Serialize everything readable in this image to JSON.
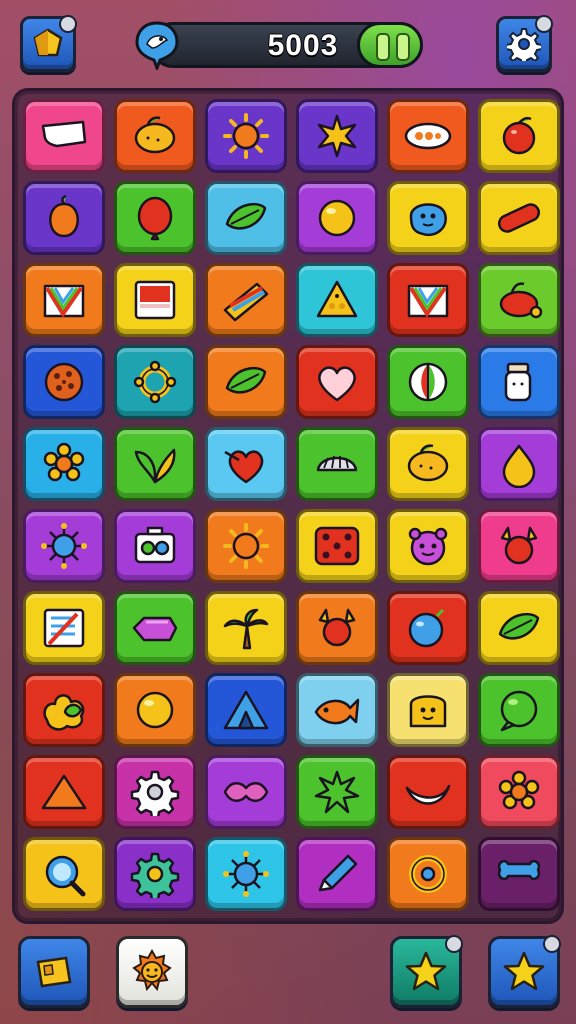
{
  "header": {
    "menu_icon": "gem-icon",
    "score": "5003",
    "settings_icon": "gear-icon",
    "score_badge_icon": "bird-badge-icon"
  },
  "board": {
    "columns": 6,
    "rows": 10,
    "tiles": [
      {
        "color": "#f0468c",
        "icon": "bandage"
      },
      {
        "color": "#f15a1e",
        "icon": "lemon"
      },
      {
        "color": "#6a35c9",
        "icon": "sun"
      },
      {
        "color": "#6a35c9",
        "icon": "star-burst"
      },
      {
        "color": "#f15a1e",
        "icon": "capsule"
      },
      {
        "color": "#f5d21a",
        "icon": "apple"
      },
      {
        "color": "#6a35c9",
        "icon": "peach"
      },
      {
        "color": "#4cc22c",
        "icon": "balloon"
      },
      {
        "color": "#4fbfe8",
        "icon": "leaf"
      },
      {
        "color": "#a43cd8",
        "icon": "orb"
      },
      {
        "color": "#f5d21a",
        "icon": "blob"
      },
      {
        "color": "#f5d21a",
        "icon": "tube"
      },
      {
        "color": "#f07a1c",
        "icon": "prism"
      },
      {
        "color": "#f5d21a",
        "icon": "card"
      },
      {
        "color": "#f07a1c",
        "icon": "ruler"
      },
      {
        "color": "#2ec5d8",
        "icon": "cheese"
      },
      {
        "color": "#e0321e",
        "icon": "prism"
      },
      {
        "color": "#6ccb2c",
        "icon": "cherry"
      },
      {
        "color": "#2456d8",
        "icon": "cookie"
      },
      {
        "color": "#1ea3b0",
        "icon": "ring"
      },
      {
        "color": "#f07a1c",
        "icon": "leaf"
      },
      {
        "color": "#e0321e",
        "icon": "heart"
      },
      {
        "color": "#4cc22c",
        "icon": "ball"
      },
      {
        "color": "#2a7ae8",
        "icon": "jar"
      },
      {
        "color": "#2ab0e8",
        "icon": "flower"
      },
      {
        "color": "#4cc22c",
        "icon": "sprout"
      },
      {
        "color": "#5ac8f0",
        "icon": "heart-pin"
      },
      {
        "color": "#4cc22c",
        "icon": "shell"
      },
      {
        "color": "#f5d21a",
        "icon": "lemon"
      },
      {
        "color": "#a43cd8",
        "icon": "drop"
      },
      {
        "color": "#a43cd8",
        "icon": "virus"
      },
      {
        "color": "#a43cd8",
        "icon": "camera"
      },
      {
        "color": "#f07a1c",
        "icon": "sun"
      },
      {
        "color": "#f5d21a",
        "icon": "dice"
      },
      {
        "color": "#f5d21a",
        "icon": "bear"
      },
      {
        "color": "#ef3c8c",
        "icon": "crab"
      },
      {
        "color": "#f5d21a",
        "icon": "notebook"
      },
      {
        "color": "#4cc22c",
        "icon": "candy"
      },
      {
        "color": "#f5d21a",
        "icon": "palm"
      },
      {
        "color": "#f07a1c",
        "icon": "crab"
      },
      {
        "color": "#e0321e",
        "icon": "plum"
      },
      {
        "color": "#f5d21a",
        "icon": "leaf"
      },
      {
        "color": "#e0321e",
        "icon": "bush"
      },
      {
        "color": "#f07a1c",
        "icon": "orb"
      },
      {
        "color": "#2456d8",
        "icon": "tent"
      },
      {
        "color": "#7ed0ee",
        "icon": "fish"
      },
      {
        "color": "#f5e070",
        "icon": "toast"
      },
      {
        "color": "#4cc22c",
        "icon": "bubble"
      },
      {
        "color": "#e0321e",
        "icon": "triangle"
      },
      {
        "color": "#c832a8",
        "icon": "gear"
      },
      {
        "color": "#a43cd8",
        "icon": "ribbon"
      },
      {
        "color": "#4cc22c",
        "icon": "splat"
      },
      {
        "color": "#e0321e",
        "icon": "banana"
      },
      {
        "color": "#f04a5e",
        "icon": "flower"
      },
      {
        "color": "#f5c21a",
        "icon": "lens"
      },
      {
        "color": "#8a30c8",
        "icon": "cog"
      },
      {
        "color": "#2ec5e8",
        "icon": "virus"
      },
      {
        "color": "#b02ec0",
        "icon": "pen"
      },
      {
        "color": "#f07a1c",
        "icon": "target"
      },
      {
        "color": "#6a2068",
        "icon": "bone"
      }
    ]
  },
  "footer": {
    "left_buttons": [
      {
        "icon": "ticket-icon",
        "color": "#2a6ae0"
      },
      {
        "icon": "sun-face-icon",
        "color": "#f4f4f0"
      }
    ],
    "right_buttons": [
      {
        "icon": "star-icon",
        "color": "#159a80"
      },
      {
        "icon": "star-icon",
        "color": "#1e56b8"
      }
    ]
  },
  "colors": {
    "bg_top": "#a24f66",
    "bg_bottom": "#7a3f55",
    "board_frame": "#2b1830",
    "score_green": "#5ac23a"
  }
}
